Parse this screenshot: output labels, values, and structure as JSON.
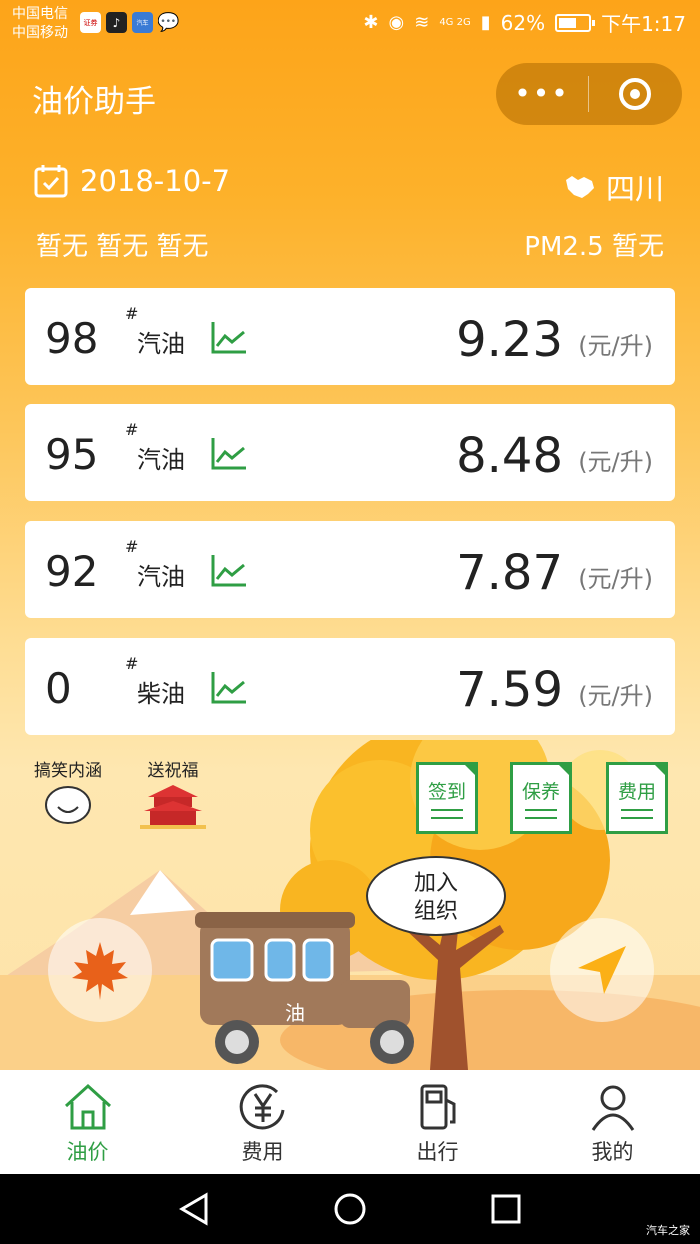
{
  "status_bar": {
    "carrier1": "中国电信",
    "carrier2": "中国移动",
    "network": "4G 2G",
    "battery_percent": "62%",
    "battery_level": 0.62,
    "time": "下午1:17"
  },
  "header": {
    "title": "油价助手",
    "more_label": "•••"
  },
  "info": {
    "date": "2018-10-7",
    "region": "四川",
    "weather": "暂无 暂无 暂无",
    "pm25": "PM2.5 暂无"
  },
  "prices": [
    {
      "grade": "98",
      "hash": "#",
      "fuel": "汽油",
      "price": "9.23",
      "unit": "(元/升)"
    },
    {
      "grade": "95",
      "hash": "#",
      "fuel": "汽油",
      "price": "8.48",
      "unit": "(元/升)"
    },
    {
      "grade": "92",
      "hash": "#",
      "fuel": "汽油",
      "price": "7.87",
      "unit": "(元/升)"
    },
    {
      "grade": "0",
      "hash": "#",
      "fuel": "柴油",
      "price": "7.59",
      "unit": "(元/升)"
    }
  ],
  "stickers": {
    "jokes": "搞笑内涵",
    "blessing": "送祝福"
  },
  "actions": {
    "checkin": "签到",
    "maintenance": "保养",
    "expense": "费用"
  },
  "scene": {
    "bubble": "加入\n组织",
    "car_label": "油"
  },
  "tabs": [
    {
      "label": "油价",
      "icon": "home-icon"
    },
    {
      "label": "费用",
      "icon": "yuan-icon"
    },
    {
      "label": "出行",
      "icon": "fuel-pump-icon"
    },
    {
      "label": "我的",
      "icon": "user-icon"
    }
  ],
  "colors": {
    "accent_green": "#2f9e44",
    "header_orange": "#fda419"
  },
  "watermark": "汽车之家"
}
